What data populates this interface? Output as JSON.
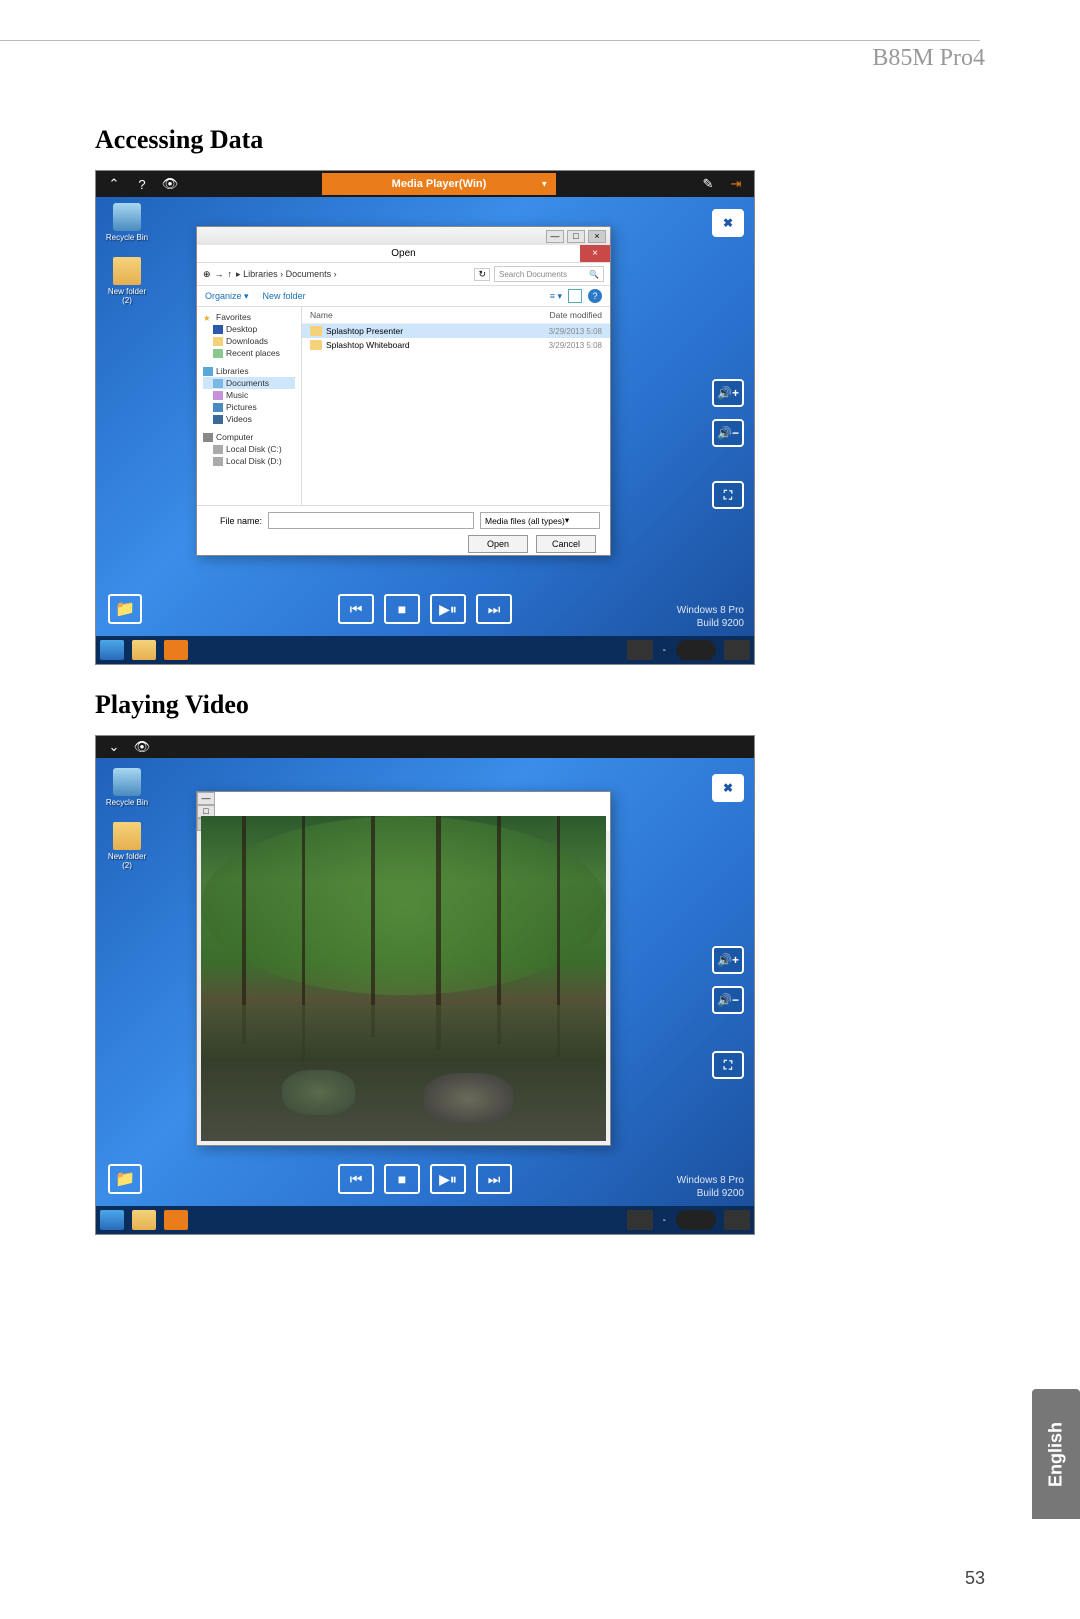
{
  "product_name": "B85M Pro4",
  "page_number": "53",
  "language_tab": "English",
  "section1_title": "Accessing Data",
  "section2_title": "Playing Video",
  "topbar_title": "Media Player(Win)",
  "desktop": {
    "recycle_bin": "Recycle Bin",
    "new_folder": "New folder (2)"
  },
  "watermark": {
    "line1": "Windows 8 Pro",
    "line2": "Build 9200"
  },
  "dialog": {
    "title": "Open",
    "breadcrumb": "Libraries  ›  Documents  ›",
    "search_placeholder": "Search Documents",
    "organize": "Organize ▾",
    "new_folder": "New folder",
    "col_name": "Name",
    "col_date": "Date modified",
    "tree": {
      "favorites": "Favorites",
      "desktop": "Desktop",
      "downloads": "Downloads",
      "recent": "Recent places",
      "libraries": "Libraries",
      "documents": "Documents",
      "music": "Music",
      "pictures": "Pictures",
      "videos": "Videos",
      "computer": "Computer",
      "localc": "Local Disk (C:)",
      "locald": "Local Disk (D:)"
    },
    "files": [
      {
        "name": "Splashtop Presenter",
        "date": "3/29/2013 5:08"
      },
      {
        "name": "Splashtop Whiteboard",
        "date": "3/29/2013 5:08"
      }
    ],
    "file_name_label": "File name:",
    "file_type": "Media files (all types)",
    "open_btn": "Open",
    "cancel_btn": "Cancel"
  }
}
